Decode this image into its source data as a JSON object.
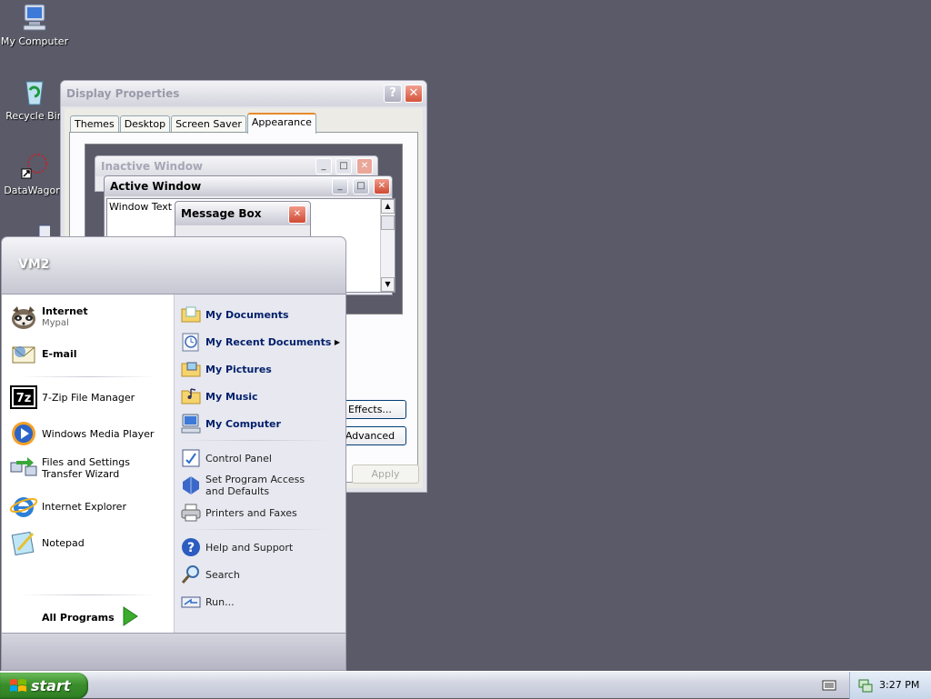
{
  "desktop": {
    "icons": [
      {
        "label": "My Computer",
        "icon": "my-computer-icon"
      },
      {
        "label": "Recycle Bin",
        "icon": "recycle-bin-icon"
      },
      {
        "label": "DataWagon.",
        "icon": "shortcut-icon"
      },
      {
        "label": "",
        "icon": "dev-icon"
      }
    ]
  },
  "display_properties": {
    "title": "Display Properties",
    "tabs": [
      "Themes",
      "Desktop",
      "Screen Saver",
      "Appearance"
    ],
    "active_tab": "Appearance",
    "preview": {
      "inactive_title": "Inactive Window",
      "active_title": "Active Window",
      "window_text": "Window Text",
      "message_box_title": "Message Box"
    },
    "buttons": {
      "effects": "Effects...",
      "advanced": "Advanced",
      "apply": "Apply"
    }
  },
  "start_menu": {
    "user": "VM2",
    "pinned": [
      {
        "label": "Internet",
        "sub": "Mypal",
        "icon": "mypal-browser-icon"
      },
      {
        "label": "E-mail",
        "sub": "",
        "icon": "email-icon"
      }
    ],
    "recent": [
      {
        "label": "7-Zip File Manager",
        "icon": "7zip-icon"
      },
      {
        "label": "Windows Media Player",
        "icon": "media-player-icon"
      },
      {
        "label": "Files and Settings Transfer Wizard",
        "icon": "transfer-wizard-icon"
      },
      {
        "label": "Internet Explorer",
        "icon": "internet-explorer-icon"
      },
      {
        "label": "Notepad",
        "icon": "notepad-icon"
      }
    ],
    "all_programs": "All Programs",
    "right_top": [
      {
        "label": "My Documents",
        "icon": "folder-documents-icon"
      },
      {
        "label": "My Recent Documents",
        "icon": "recent-documents-icon"
      },
      {
        "label": "My Pictures",
        "icon": "folder-pictures-icon"
      },
      {
        "label": "My Music",
        "icon": "folder-music-icon"
      },
      {
        "label": "My Computer",
        "icon": "my-computer-icon"
      }
    ],
    "right_mid": [
      {
        "label": "Control Panel",
        "icon": "control-panel-icon"
      },
      {
        "label": "Set Program Access and Defaults",
        "icon": "program-access-icon"
      },
      {
        "label": "Printers and Faxes",
        "icon": "printer-icon"
      }
    ],
    "right_bottom": [
      {
        "label": "Help and Support",
        "icon": "help-icon"
      },
      {
        "label": "Search",
        "icon": "search-icon"
      },
      {
        "label": "Run...",
        "icon": "run-icon"
      }
    ]
  },
  "taskbar": {
    "start_label": "start",
    "clock": "3:27 PM"
  }
}
